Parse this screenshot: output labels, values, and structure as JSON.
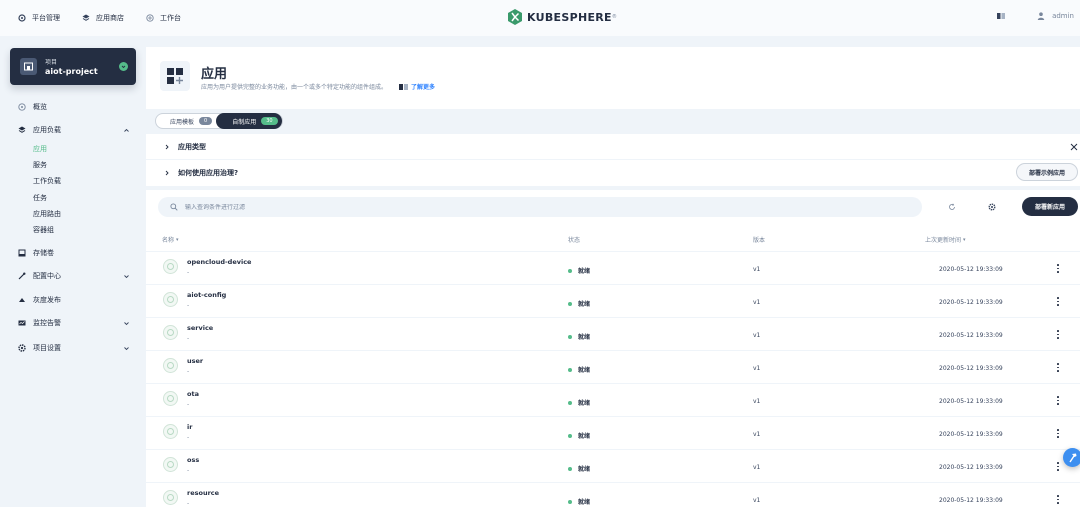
{
  "topnav": {
    "items": [
      {
        "label": "平台管理",
        "icon": "platform-icon"
      },
      {
        "label": "应用商店",
        "icon": "appstore-icon"
      },
      {
        "label": "工作台",
        "icon": "workbench-icon"
      }
    ],
    "logo_text": "KUBESPHERE",
    "logo_tm": "®",
    "user": "admin"
  },
  "sidebar": {
    "project_label": "项目",
    "project_name": "aiot-project",
    "menu": [
      {
        "label": "概览",
        "icon": "overview-icon"
      },
      {
        "label": "应用负载",
        "icon": "workload-icon"
      },
      {
        "label": "存储卷",
        "icon": "volume-icon"
      },
      {
        "label": "配置中心",
        "icon": "config-icon"
      },
      {
        "label": "灰度发布",
        "icon": "grayscale-icon"
      },
      {
        "label": "监控告警",
        "icon": "monitor-icon"
      },
      {
        "label": "项目设置",
        "icon": "settings-icon"
      }
    ],
    "submenu": [
      "应用",
      "服务",
      "工作负载",
      "任务",
      "应用路由",
      "容器组"
    ]
  },
  "header": {
    "title": "应用",
    "description": "应用为用户提供完整的业务功能，由一个或多个特定功能的组件组成。",
    "learn_more": "了解更多"
  },
  "tabs": [
    {
      "label": "应用模板",
      "count": "0"
    },
    {
      "label": "自制应用",
      "count": "30"
    }
  ],
  "panel": {
    "row1": "应用类型",
    "row2": "如何使用应用治理?",
    "deploy_sample": "部署示例应用"
  },
  "toolbar": {
    "search_placeholder": "输入查询条件进行过滤",
    "create_label": "部署新应用"
  },
  "table": {
    "headers": {
      "name": "名称",
      "status": "状态",
      "version": "版本",
      "updated": "上次更新时间"
    },
    "rows": [
      {
        "name": "opencloud-device",
        "sub": "-",
        "status": "就绪",
        "version": "v1",
        "time": "2020-05-12 19:33:09"
      },
      {
        "name": "aiot-config",
        "sub": "-",
        "status": "就绪",
        "version": "v1",
        "time": "2020-05-12 19:33:09"
      },
      {
        "name": "service",
        "sub": "-",
        "status": "就绪",
        "version": "v1",
        "time": "2020-05-12 19:33:09"
      },
      {
        "name": "user",
        "sub": "-",
        "status": "就绪",
        "version": "v1",
        "time": "2020-05-12 19:33:09"
      },
      {
        "name": "ota",
        "sub": "-",
        "status": "就绪",
        "version": "v1",
        "time": "2020-05-12 19:33:09"
      },
      {
        "name": "ir",
        "sub": "-",
        "status": "就绪",
        "version": "v1",
        "time": "2020-05-12 19:33:09"
      },
      {
        "name": "oss",
        "sub": "-",
        "status": "就绪",
        "version": "v1",
        "time": "2020-05-12 19:33:09"
      },
      {
        "name": "resource",
        "sub": "-",
        "status": "就绪",
        "version": "v1",
        "time": "2020-05-12 19:33:09"
      }
    ]
  },
  "colors": {
    "accent": "#55bc8a",
    "dark": "#242e42",
    "link": "#3385ff"
  }
}
